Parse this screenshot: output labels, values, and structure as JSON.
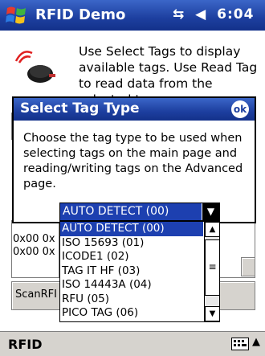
{
  "titlebar": {
    "app_title": "RFID Demo",
    "status": "↔ₓ ◀€ 6:04",
    "time": "6:04"
  },
  "main": {
    "help_text": "Use Select Tags to display available tags.  Use Read Tag to read data from the selected tag.",
    "list_rows": [
      "0x00 0x",
      "0x00 0x"
    ],
    "scan_button": "ScanRFI"
  },
  "dialog": {
    "title": "Select Tag Type",
    "ok_label": "ok",
    "message": "Choose the tag type to be used when selecting tags on the main page and reading/writing tags on the Advanced page.",
    "combo_value": "AUTO DETECT (00)",
    "options": [
      "AUTO DETECT (00)",
      "ISO 15693 (01)",
      "ICODE1 (02)",
      "TAG IT HF (03)",
      "ISO 14443A (04)",
      "RFU (05)",
      "PICO TAG (06)"
    ],
    "selected_index": 0
  },
  "menubar": {
    "left_menu": "RFID"
  },
  "colors": {
    "title_blue": "#1d3f9f",
    "highlight": "#1d40b0",
    "menubar_gray": "#d6d3ce"
  }
}
